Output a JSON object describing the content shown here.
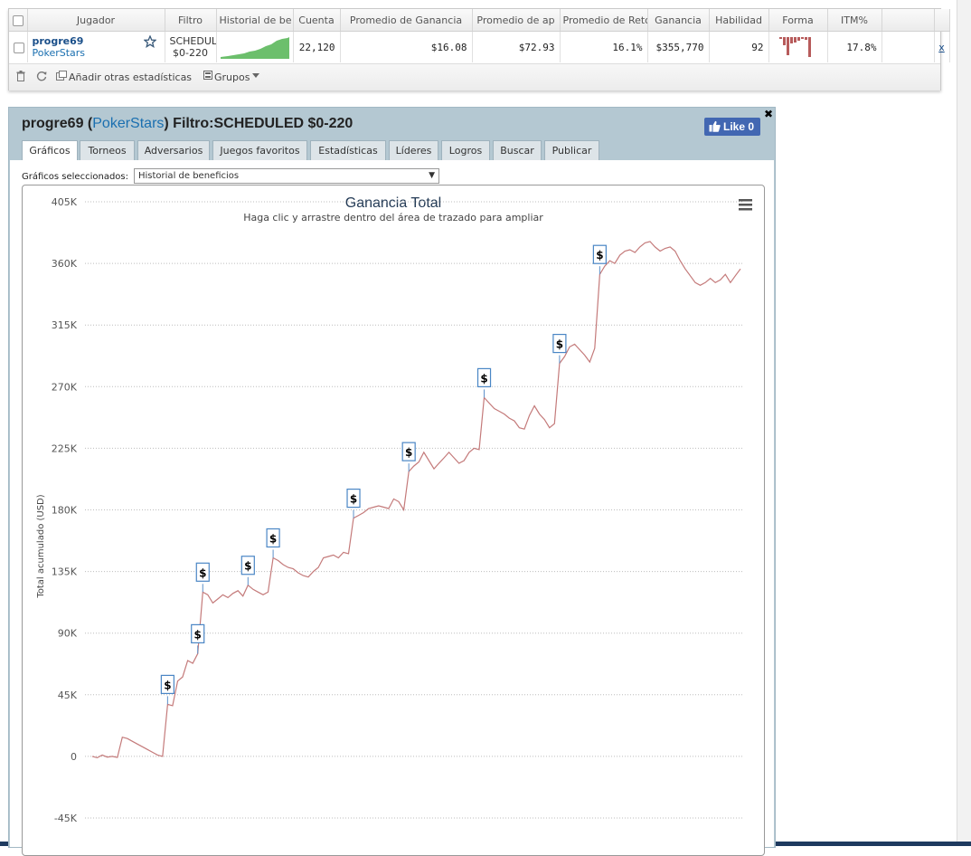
{
  "table": {
    "headers": [
      "Jugador",
      "Filtro",
      "Historial de be",
      "Cuenta",
      "Promedio de Ganancia",
      "Promedio de ap",
      "Promedio de Retorno",
      "Ganancia",
      "Habilidad",
      "Forma",
      "ITM%"
    ],
    "row": {
      "player": "progre69",
      "site": "PokerStars",
      "filter_line1": "SCHEDUL",
      "filter_line2": "$0-220",
      "count": "22,120",
      "avg_profit": "$16.08",
      "avg_stake": "$72.93",
      "avg_roi": "16.1%",
      "profit": "$355,770",
      "ability": "92",
      "itm": "17.8%",
      "remove": "x"
    },
    "toolbar": {
      "add_stats": "Añadir otras estadísticas",
      "groups": "Grupos"
    }
  },
  "panel": {
    "player": "progre69",
    "site": "PokerStars",
    "filter": "Filtro:SCHEDULED $0-220",
    "like": "Like 0",
    "tabs": [
      "Gráficos",
      "Torneos",
      "Adversarios",
      "Juegos favoritos",
      "Estadísticas",
      "Líderes",
      "Logros",
      "Buscar",
      "Publicar"
    ],
    "selected_label": "Gráficos seleccionados:",
    "selected_value": "Historial de beneficios"
  },
  "chart_data": {
    "type": "line",
    "title": "Ganancia Total",
    "subtitle": "Haga clic y arrastre dentro del área de trazado para ampliar",
    "ylabel": "Total acumulado (USD)",
    "ylim": [
      -45000,
      405000
    ],
    "yticks": [
      "405K",
      "360K",
      "315K",
      "270K",
      "225K",
      "180K",
      "135K",
      "90K",
      "45K",
      "0",
      "-45K"
    ],
    "ytick_values": [
      405000,
      360000,
      315000,
      270000,
      225000,
      180000,
      135000,
      90000,
      45000,
      0,
      -45000
    ],
    "color": "#c47a7a",
    "series": [
      {
        "values": [
          0,
          -1000,
          1000,
          -500,
          0,
          -800,
          14000,
          13000,
          11000,
          9000,
          7000,
          5000,
          3000,
          1000,
          0,
          38000,
          37000,
          55000,
          58000,
          70000,
          68000,
          75000,
          120000,
          118000,
          112000,
          115000,
          118000,
          116000,
          119000,
          121000,
          117000,
          125000,
          122000,
          120000,
          118000,
          120000,
          145000,
          143000,
          140000,
          138000,
          137000,
          134000,
          132000,
          131000,
          135000,
          138000,
          145000,
          146000,
          147000,
          145000,
          149000,
          148000,
          174000,
          176000,
          178000,
          181000,
          182000,
          183000,
          182000,
          181000,
          188000,
          186000,
          180000,
          208000,
          212000,
          215000,
          222000,
          216000,
          210000,
          214000,
          218000,
          222000,
          218000,
          214000,
          216000,
          222000,
          225000,
          224000,
          262000,
          258000,
          254000,
          252000,
          250000,
          247000,
          245000,
          240000,
          239000,
          249000,
          256000,
          250000,
          246000,
          240000,
          243000,
          287000,
          292000,
          299000,
          301000,
          297000,
          293000,
          288000,
          298000,
          352000,
          358000,
          362000,
          360000,
          366000,
          369000,
          370000,
          368000,
          372000,
          375000,
          376000,
          372000,
          369000,
          371000,
          372000,
          369000,
          362000,
          356000,
          351000,
          346000,
          344000,
          346000,
          349000,
          346000,
          348000,
          352000,
          346000,
          351000,
          356000
        ]
      }
    ],
    "markers": [
      {
        "index": 15,
        "label": "$"
      },
      {
        "index": 21,
        "label": "$"
      },
      {
        "index": 22,
        "label": "$"
      },
      {
        "index": 31,
        "label": "$"
      },
      {
        "index": 36,
        "label": "$"
      },
      {
        "index": 52,
        "label": "$"
      },
      {
        "index": 63,
        "label": "$"
      },
      {
        "index": 78,
        "label": "$"
      },
      {
        "index": 93,
        "label": "$"
      },
      {
        "index": 101,
        "label": "$"
      }
    ],
    "grid": true
  }
}
